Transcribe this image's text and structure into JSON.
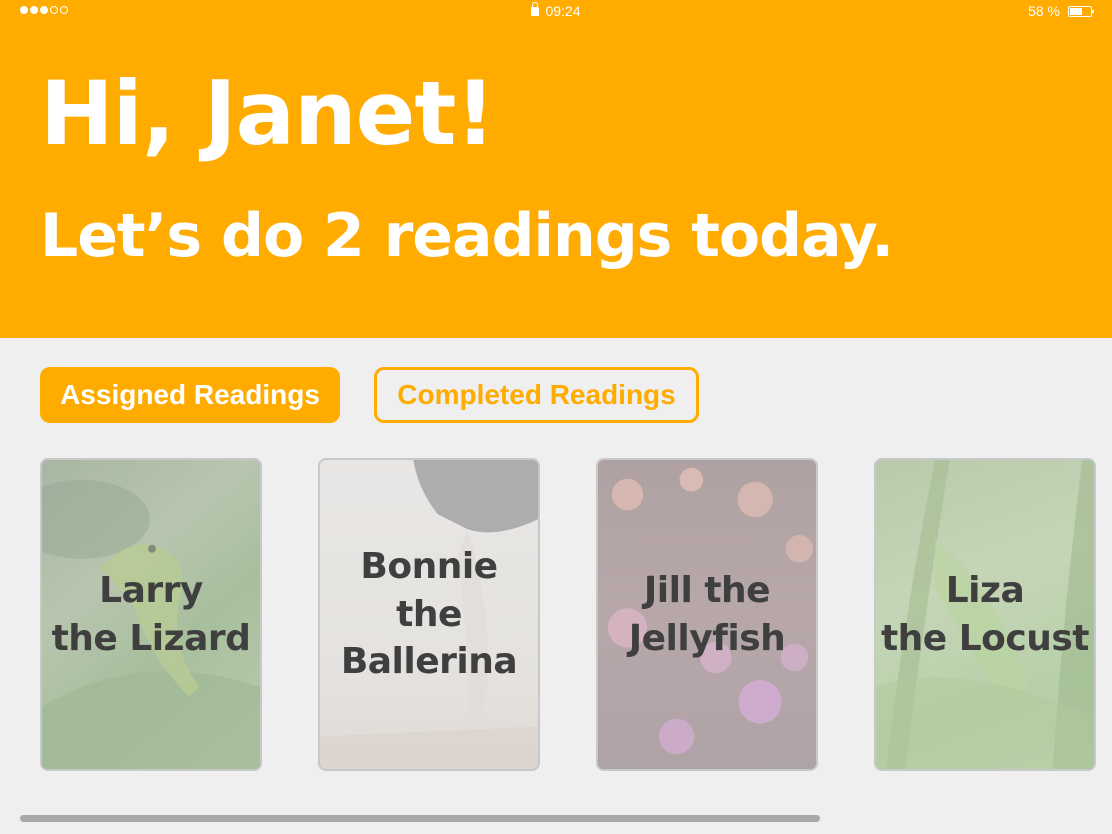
{
  "status_bar": {
    "signal_bars_filled": 3,
    "signal_bars_total": 5,
    "time": "09:24",
    "battery_text": "58 %",
    "battery_level": 0.58
  },
  "header": {
    "greeting": "Hi, Janet!",
    "subtitle": "Let’s do 2 readings today."
  },
  "tabs": [
    {
      "label": "Assigned Readings",
      "selected": true
    },
    {
      "label": "Completed Readings",
      "selected": false
    }
  ],
  "readings": [
    {
      "line1": "Larry",
      "line2": "the Lizard",
      "line3": ""
    },
    {
      "line1": "Bonnie",
      "line2": "the",
      "line3": "Ballerina"
    },
    {
      "line1": "Jill the",
      "line2": "Jellyfish",
      "line3": ""
    },
    {
      "line1": "Liza",
      "line2": "the Locust",
      "line3": ""
    }
  ],
  "colors": {
    "accent": "#ffab00",
    "card_text": "#3f3f3f",
    "background": "#efefef"
  }
}
